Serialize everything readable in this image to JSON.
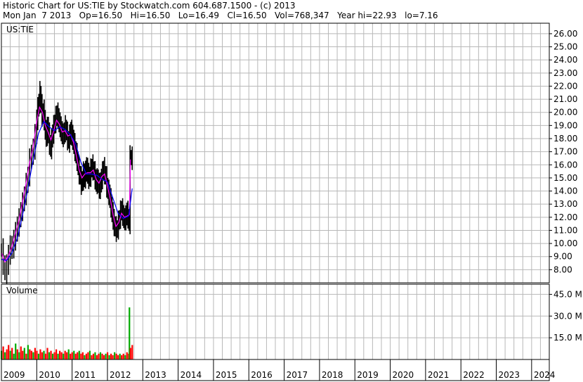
{
  "header": {
    "line1": "Historic Chart for US:TIE by Stockwatch.com 604.687.1500 - (c) 2013",
    "line2": "Mon Jan  7 2013   Op=16.50   Hi=16.50   Lo=16.49   Cl=16.50   Vol=768,347   Year hi=22.93   lo=7.16"
  },
  "colors": {
    "grid": "#b8b8b8",
    "price_bar": "#000000",
    "ma_fast": "#ff00ff",
    "ma_slow": "#0000ff",
    "volume_up": "#00aa00",
    "volume_down": "#ff0000"
  },
  "chart_data": [
    {
      "type": "line",
      "panel_label": "US:TIE",
      "xlim": [
        2009,
        2024.5
      ],
      "ylim": [
        7.0,
        26.8
      ],
      "y_ticks": [
        "26.00",
        "25.00",
        "24.00",
        "23.00",
        "22.00",
        "21.00",
        "20.00",
        "19.00",
        "18.00",
        "17.00",
        "16.00",
        "15.00",
        "14.00",
        "13.00",
        "12.00",
        "11.00",
        "10.00",
        "9.00",
        "8.00"
      ],
      "series": [
        {
          "style": "price-range",
          "points": [
            [
              2009.0,
              9.5
            ],
            [
              2009.05,
              8.5
            ],
            [
              2009.1,
              7.8
            ],
            [
              2009.15,
              8.3
            ],
            [
              2009.2,
              9.2
            ],
            [
              2009.25,
              9.8
            ],
            [
              2009.3,
              9.6
            ],
            [
              2009.35,
              10.3
            ],
            [
              2009.4,
              10.8
            ],
            [
              2009.45,
              11.4
            ],
            [
              2009.5,
              11.8
            ],
            [
              2009.55,
              12.6
            ],
            [
              2009.6,
              13.0
            ],
            [
              2009.65,
              13.8
            ],
            [
              2009.7,
              14.5
            ],
            [
              2009.75,
              15.2
            ],
            [
              2009.8,
              16.4
            ],
            [
              2009.85,
              16.8
            ],
            [
              2009.9,
              17.2
            ],
            [
              2009.95,
              18.3
            ],
            [
              2010.0,
              19.5
            ],
            [
              2010.03,
              20.3
            ],
            [
              2010.06,
              20.8
            ],
            [
              2010.09,
              21.5
            ],
            [
              2010.12,
              20.5
            ],
            [
              2010.15,
              19.8
            ],
            [
              2010.18,
              20.1
            ],
            [
              2010.21,
              19.5
            ],
            [
              2010.24,
              18.6
            ],
            [
              2010.27,
              18.2
            ],
            [
              2010.3,
              18.9
            ],
            [
              2010.33,
              18.4
            ],
            [
              2010.36,
              17.6
            ],
            [
              2010.39,
              17.3
            ],
            [
              2010.42,
              17.9
            ],
            [
              2010.45,
              18.5
            ],
            [
              2010.48,
              18.9
            ],
            [
              2010.51,
              19.3
            ],
            [
              2010.54,
              19.6
            ],
            [
              2010.57,
              19.9
            ],
            [
              2010.6,
              19.6
            ],
            [
              2010.63,
              19.2
            ],
            [
              2010.66,
              18.9
            ],
            [
              2010.69,
              18.6
            ],
            [
              2010.72,
              18.3
            ],
            [
              2010.75,
              18.2
            ],
            [
              2010.78,
              18.6
            ],
            [
              2010.81,
              18.9
            ],
            [
              2010.84,
              18.4
            ],
            [
              2010.87,
              18.0
            ],
            [
              2010.9,
              17.8
            ],
            [
              2010.93,
              18.2
            ],
            [
              2010.96,
              18.6
            ],
            [
              2010.99,
              18.3
            ],
            [
              2011.02,
              17.9
            ],
            [
              2011.05,
              17.6
            ],
            [
              2011.08,
              17.1
            ],
            [
              2011.11,
              16.8
            ],
            [
              2011.14,
              16.4
            ],
            [
              2011.17,
              15.8
            ],
            [
              2011.2,
              15.4
            ],
            [
              2011.23,
              15.0
            ],
            [
              2011.26,
              14.6
            ],
            [
              2011.29,
              14.9
            ],
            [
              2011.32,
              15.4
            ],
            [
              2011.35,
              15.0
            ],
            [
              2011.38,
              15.5
            ],
            [
              2011.41,
              15.8
            ],
            [
              2011.44,
              15.3
            ],
            [
              2011.47,
              15.0
            ],
            [
              2011.5,
              15.2
            ],
            [
              2011.53,
              15.6
            ],
            [
              2011.56,
              15.9
            ],
            [
              2011.59,
              15.7
            ],
            [
              2011.62,
              15.4
            ],
            [
              2011.65,
              15.0
            ],
            [
              2011.68,
              14.6
            ],
            [
              2011.71,
              14.9
            ],
            [
              2011.74,
              14.6
            ],
            [
              2011.77,
              14.2
            ],
            [
              2011.8,
              14.6
            ],
            [
              2011.83,
              15.0
            ],
            [
              2011.86,
              15.4
            ],
            [
              2011.89,
              15.7
            ],
            [
              2011.92,
              15.4
            ],
            [
              2011.95,
              15.0
            ],
            [
              2011.98,
              14.4
            ],
            [
              2012.01,
              14.0
            ],
            [
              2012.04,
              13.8
            ],
            [
              2012.07,
              13.4
            ],
            [
              2012.1,
              12.8
            ],
            [
              2012.13,
              12.4
            ],
            [
              2012.16,
              11.8
            ],
            [
              2012.19,
              11.4
            ],
            [
              2012.22,
              11.2
            ],
            [
              2012.25,
              11.0
            ],
            [
              2012.28,
              11.2
            ],
            [
              2012.31,
              11.6
            ],
            [
              2012.34,
              12.0
            ],
            [
              2012.37,
              12.4
            ],
            [
              2012.4,
              12.6
            ],
            [
              2012.43,
              12.2
            ],
            [
              2012.46,
              11.9
            ],
            [
              2012.49,
              11.8
            ],
            [
              2012.52,
              12.1
            ],
            [
              2012.55,
              12.4
            ],
            [
              2012.58,
              12.0
            ],
            [
              2012.61,
              11.6
            ],
            [
              2012.64,
              16.6
            ],
            [
              2012.67,
              16.5
            ],
            [
              2012.7,
              16.5
            ]
          ]
        },
        {
          "name": "",
          "style": "ma-fast",
          "points": [
            [
              2009.0,
              9.3
            ],
            [
              2009.1,
              8.6
            ],
            [
              2009.2,
              9.1
            ],
            [
              2009.3,
              9.8
            ],
            [
              2009.4,
              10.8
            ],
            [
              2009.5,
              11.8
            ],
            [
              2009.6,
              13.2
            ],
            [
              2009.7,
              14.6
            ],
            [
              2009.8,
              16.2
            ],
            [
              2009.9,
              17.4
            ],
            [
              2010.0,
              19.3
            ],
            [
              2010.08,
              20.4
            ],
            [
              2010.16,
              20.0
            ],
            [
              2010.24,
              19.0
            ],
            [
              2010.32,
              18.5
            ],
            [
              2010.4,
              17.9
            ],
            [
              2010.48,
              18.6
            ],
            [
              2010.56,
              19.4
            ],
            [
              2010.64,
              19.1
            ],
            [
              2010.72,
              18.5
            ],
            [
              2010.8,
              18.6
            ],
            [
              2010.88,
              18.2
            ],
            [
              2010.96,
              18.3
            ],
            [
              2011.04,
              17.7
            ],
            [
              2011.12,
              16.7
            ],
            [
              2011.2,
              15.6
            ],
            [
              2011.28,
              15.0
            ],
            [
              2011.36,
              15.3
            ],
            [
              2011.44,
              15.4
            ],
            [
              2011.52,
              15.4
            ],
            [
              2011.6,
              15.6
            ],
            [
              2011.68,
              14.9
            ],
            [
              2011.76,
              14.6
            ],
            [
              2011.84,
              15.1
            ],
            [
              2011.92,
              15.3
            ],
            [
              2012.0,
              14.4
            ],
            [
              2012.08,
              13.4
            ],
            [
              2012.16,
              12.2
            ],
            [
              2012.24,
              11.3
            ],
            [
              2012.32,
              11.6
            ],
            [
              2012.4,
              12.3
            ],
            [
              2012.48,
              12.0
            ],
            [
              2012.56,
              12.1
            ],
            [
              2012.62,
              12.2
            ],
            [
              2012.65,
              16.4
            ]
          ]
        },
        {
          "name": "",
          "style": "ma-slow",
          "points": [
            [
              2009.0,
              8.8
            ],
            [
              2009.15,
              8.7
            ],
            [
              2009.3,
              9.3
            ],
            [
              2009.45,
              10.4
            ],
            [
              2009.6,
              12.2
            ],
            [
              2009.75,
              14.2
            ],
            [
              2009.9,
              16.4
            ],
            [
              2010.05,
              18.4
            ],
            [
              2010.2,
              19.3
            ],
            [
              2010.35,
              18.9
            ],
            [
              2010.5,
              18.6
            ],
            [
              2010.65,
              18.9
            ],
            [
              2010.8,
              18.7
            ],
            [
              2010.95,
              18.3
            ],
            [
              2011.1,
              17.6
            ],
            [
              2011.25,
              16.2
            ],
            [
              2011.4,
              15.3
            ],
            [
              2011.55,
              15.3
            ],
            [
              2011.7,
              15.2
            ],
            [
              2011.85,
              14.9
            ],
            [
              2012.0,
              14.7
            ],
            [
              2012.15,
              13.5
            ],
            [
              2012.3,
              12.3
            ],
            [
              2012.45,
              11.9
            ],
            [
              2012.6,
              12.1
            ],
            [
              2012.7,
              14.2
            ]
          ]
        }
      ]
    },
    {
      "type": "bar",
      "panel_label": "Volume",
      "ylim": [
        0,
        52
      ],
      "y_ticks": [
        "45.0 M",
        "30.0 M",
        "15.0 M"
      ],
      "x_ticks": [
        "2009",
        "2010",
        "2011",
        "2012",
        "2013",
        "2014",
        "2015",
        "2016",
        "2017",
        "2018",
        "2019",
        "2020",
        "2021",
        "2022",
        "2023",
        "2024"
      ],
      "x": [
        2009.0,
        2009.05,
        2009.1,
        2009.15,
        2009.2,
        2009.25,
        2009.3,
        2009.35,
        2009.4,
        2009.45,
        2009.5,
        2009.55,
        2009.6,
        2009.65,
        2009.7,
        2009.75,
        2009.8,
        2009.85,
        2009.9,
        2009.95,
        2010.0,
        2010.05,
        2010.1,
        2010.15,
        2010.2,
        2010.25,
        2010.3,
        2010.35,
        2010.4,
        2010.45,
        2010.5,
        2010.55,
        2010.6,
        2010.65,
        2010.7,
        2010.75,
        2010.8,
        2010.85,
        2010.9,
        2010.95,
        2011.0,
        2011.05,
        2011.1,
        2011.15,
        2011.2,
        2011.25,
        2011.3,
        2011.35,
        2011.4,
        2011.45,
        2011.5,
        2011.55,
        2011.6,
        2011.65,
        2011.7,
        2011.75,
        2011.8,
        2011.85,
        2011.9,
        2011.95,
        2012.0,
        2012.05,
        2012.1,
        2012.15,
        2012.2,
        2012.25,
        2012.3,
        2012.35,
        2012.4,
        2012.45,
        2012.5,
        2012.55,
        2012.6,
        2012.62,
        2012.65,
        2012.7
      ],
      "values": [
        6,
        9,
        5,
        7,
        10,
        6,
        8,
        4,
        11,
        7,
        5,
        9,
        6,
        8,
        4,
        10,
        7,
        6,
        5,
        8,
        6,
        4,
        7,
        5,
        6,
        4,
        8,
        5,
        6,
        4,
        5,
        7,
        4,
        6,
        5,
        4,
        6,
        5,
        7,
        4,
        5,
        6,
        4,
        5,
        6,
        4,
        5,
        3,
        4,
        5,
        6,
        3,
        4,
        5,
        3,
        4,
        5,
        4,
        3,
        4,
        5,
        3,
        4,
        3,
        5,
        4,
        3,
        4,
        3,
        4,
        3,
        5,
        4,
        36,
        8,
        10
      ],
      "colors": [
        "green",
        "red",
        "green",
        "red",
        "red",
        "green",
        "red",
        "green",
        "green",
        "red",
        "green",
        "red",
        "red",
        "green",
        "red",
        "green",
        "red",
        "red",
        "green",
        "red",
        "red",
        "green",
        "red",
        "red",
        "green",
        "red",
        "red",
        "green",
        "red",
        "green",
        "red",
        "red",
        "green",
        "red",
        "red",
        "green",
        "red",
        "red",
        "green",
        "red",
        "red",
        "green",
        "red",
        "red",
        "green",
        "red",
        "red",
        "green",
        "red",
        "red",
        "green",
        "red",
        "red",
        "green",
        "red",
        "red",
        "green",
        "red",
        "red",
        "green",
        "red",
        "green",
        "red",
        "red",
        "green",
        "red",
        "red",
        "green",
        "red",
        "red",
        "green",
        "red",
        "red",
        "green",
        "red",
        "red"
      ]
    }
  ]
}
